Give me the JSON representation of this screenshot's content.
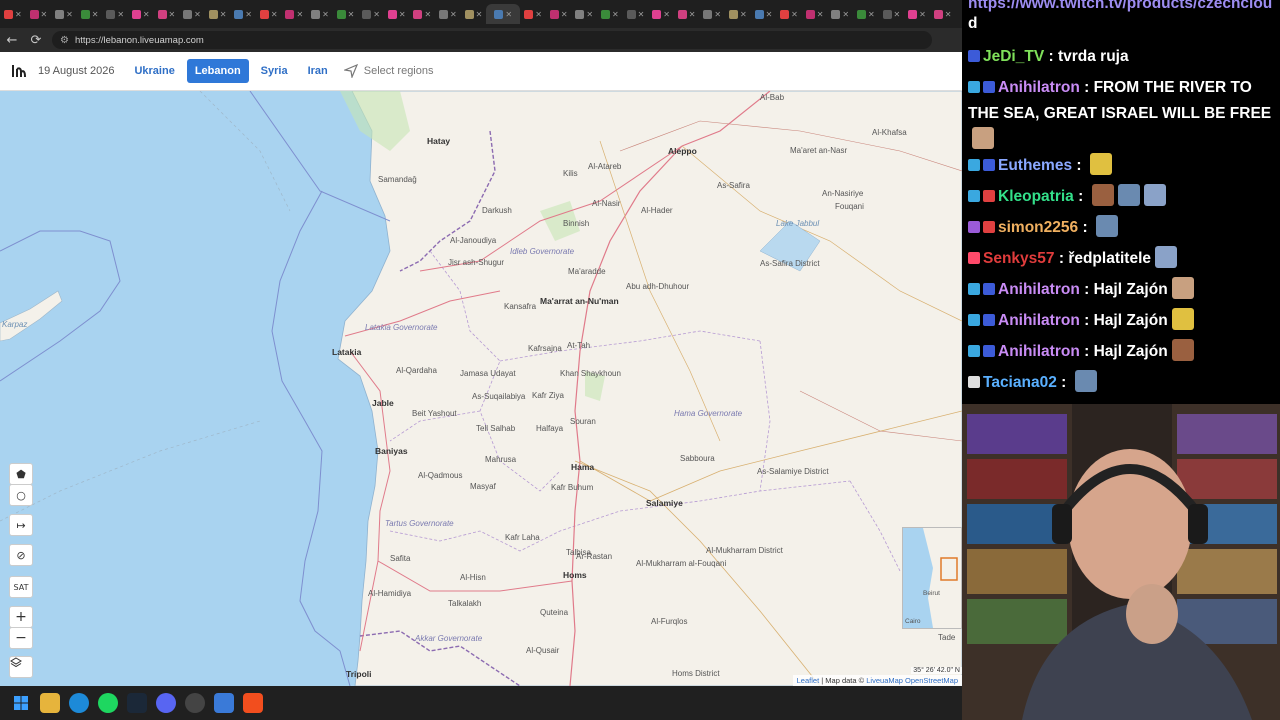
{
  "browser": {
    "url": "https://lebanon.liveuamap.com",
    "tab_count": 37
  },
  "site": {
    "date": "19 August 2026",
    "regions": [
      "Ukraine",
      "Lebanon",
      "Syria",
      "Iran"
    ],
    "active_region": "Lebanon",
    "select_regions_label": "Select regions"
  },
  "map": {
    "sea_labels": {
      "karpaz": "Karpaz"
    },
    "labels": [
      {
        "t": "Al-Bab",
        "k": "ml"
      },
      {
        "t": "Aleppo",
        "k": "city"
      },
      {
        "t": "As-Safira",
        "k": "ml"
      },
      {
        "t": "Hatay",
        "k": "city"
      },
      {
        "t": "Samandağ",
        "k": "ml"
      },
      {
        "t": "Kilis",
        "k": "ml"
      },
      {
        "t": "Al-Atareb",
        "k": "ml"
      },
      {
        "t": "Darkush",
        "k": "ml"
      },
      {
        "t": "Binnish",
        "k": "ml"
      },
      {
        "t": "Al-Nasir",
        "k": "ml"
      },
      {
        "t": "Al-Hader",
        "k": "ml"
      },
      {
        "t": "Al-Janoudiya",
        "k": "ml"
      },
      {
        "t": "Idleb Governorate",
        "k": "gov"
      },
      {
        "t": "Jisr ash-Shugur",
        "k": "ml"
      },
      {
        "t": "Ma'aradde",
        "k": "ml"
      },
      {
        "t": "Abu adh-Dhuhour",
        "k": "ml"
      },
      {
        "t": "Kansafra",
        "k": "ml"
      },
      {
        "t": "Ma'arrat an-Nu'man",
        "k": "city"
      },
      {
        "t": "Latakia Governorate",
        "k": "gov"
      },
      {
        "t": "Latakia",
        "k": "city"
      },
      {
        "t": "Kafrsajna",
        "k": "ml"
      },
      {
        "t": "At-Tah",
        "k": "ml"
      },
      {
        "t": "Al-Qardaha",
        "k": "ml"
      },
      {
        "t": "Jamasa Udayat",
        "k": "ml"
      },
      {
        "t": "Khan Shaykhoun",
        "k": "ml"
      },
      {
        "t": "As-Suqailabiya",
        "k": "ml"
      },
      {
        "t": "Kafr Ziya",
        "k": "ml"
      },
      {
        "t": "Jable",
        "k": "city"
      },
      {
        "t": "Beit Yashout",
        "k": "ml"
      },
      {
        "t": "Souran",
        "k": "ml"
      },
      {
        "t": "Hama Governorate",
        "k": "gov"
      },
      {
        "t": "Halfaya",
        "k": "ml"
      },
      {
        "t": "Tell Salhab",
        "k": "ml"
      },
      {
        "t": "Sabboura",
        "k": "ml"
      },
      {
        "t": "As-Salamiye District",
        "k": "ml"
      },
      {
        "t": "Baniyas",
        "k": "city"
      },
      {
        "t": "Mahrusa",
        "k": "ml"
      },
      {
        "t": "Hama",
        "k": "city"
      },
      {
        "t": "Al-Qadmous",
        "k": "ml"
      },
      {
        "t": "Masyaf",
        "k": "ml"
      },
      {
        "t": "Kafr Buhum",
        "k": "ml"
      },
      {
        "t": "Salamiye",
        "k": "city"
      },
      {
        "t": "Tartus Governorate",
        "k": "gov"
      },
      {
        "t": "Ar-Rastan",
        "k": "ml"
      },
      {
        "t": "Safita",
        "k": "ml"
      },
      {
        "t": "Kafr Laha",
        "k": "ml"
      },
      {
        "t": "Talbisa",
        "k": "ml"
      },
      {
        "t": "Al-Mukharram al-Fouqani",
        "k": "ml"
      },
      {
        "t": "Al-Mukharram District",
        "k": "ml"
      },
      {
        "t": "Al-Hisn",
        "k": "ml"
      },
      {
        "t": "Homs",
        "k": "city"
      },
      {
        "t": "Al-Hamidiya",
        "k": "ml"
      },
      {
        "t": "Talkalakh",
        "k": "ml"
      },
      {
        "t": "Quteina",
        "k": "ml"
      },
      {
        "t": "Akkar Governorate",
        "k": "gov"
      },
      {
        "t": "Al-Furqlos",
        "k": "ml"
      },
      {
        "t": "Al-Qusair",
        "k": "ml"
      },
      {
        "t": "Tripoli",
        "k": "city"
      },
      {
        "t": "Homs District",
        "k": "ml"
      },
      {
        "t": "Lake Jabbul",
        "k": "sea"
      },
      {
        "t": "An-Nasiriye",
        "k": "ml"
      },
      {
        "t": "Fouqani",
        "k": "ml"
      },
      {
        "t": "As-Safira District",
        "k": "ml"
      },
      {
        "t": "Al-Khafsa",
        "k": "ml"
      },
      {
        "t": "Ma'aret an-Nasr",
        "k": "ml"
      }
    ],
    "minimap_labels": [
      "Beirut",
      "Cairo",
      "Tade"
    ],
    "coords": "35° 26' 42.0\" N",
    "attribution": {
      "leaflet": "Leaflet",
      "sep": " | Map data © ",
      "provider": "LiveuaMap OpenStreetMap"
    },
    "controls": [
      "polygon",
      "circle",
      "line",
      "hide",
      "SAT",
      "+",
      "−",
      "layers"
    ]
  },
  "chat": {
    "url_line": "https://www.twitch.tv/products/czechclou",
    "url_tail": "d",
    "messages": [
      {
        "user": "JeDi_TV",
        "color": "#7fe05a",
        "text": "tvrda ruja",
        "badges": [
          "#3c5bd8"
        ]
      },
      {
        "user": "Anihilatron",
        "color": "#c98cf5",
        "text": "FROM THE RIVER TO THE SEA, GREAT ISRAEL WILL BE FREE",
        "badges": [
          "#3aa8e0",
          "#3c5bd8"
        ],
        "emotes": 1
      },
      {
        "user": "Euthemes",
        "color": "#8aa8ff",
        "text": "",
        "badges": [
          "#3aa8e0",
          "#3c5bd8"
        ],
        "emotes": 1
      },
      {
        "user": "Kleopatria",
        "color": "#33e08a",
        "text": "",
        "badges": [
          "#3aa8e0",
          "#e04040"
        ],
        "emotes": 3
      },
      {
        "user": "simon2256",
        "color": "#f0b060",
        "text": "",
        "badges": [
          "#9a5bd8",
          "#e04040"
        ],
        "emotes": 1
      },
      {
        "user": "Senkys57",
        "color": "#e03c3c",
        "text": "ředplatitele",
        "badges": [
          "#ff4a6a"
        ],
        "emotes": 1
      },
      {
        "user": "Anihilatron",
        "color": "#c98cf5",
        "text": "Hajl Zajón",
        "badges": [
          "#3aa8e0",
          "#3c5bd8"
        ],
        "emotes": 1
      },
      {
        "user": "Anihilatron",
        "color": "#c98cf5",
        "text": "Hajl Zajón",
        "badges": [
          "#3aa8e0",
          "#3c5bd8"
        ],
        "emotes": 1
      },
      {
        "user": "Anihilatron",
        "color": "#c98cf5",
        "text": "Hajl Zajón",
        "badges": [
          "#3aa8e0",
          "#3c5bd8"
        ],
        "emotes": 1
      },
      {
        "user": "Taciana02",
        "color": "#5ab0ff",
        "text": "",
        "badges": [
          "#dddddd"
        ],
        "emotes": 1
      }
    ]
  },
  "taskbar": {
    "icons": [
      "windows-start",
      "file-explorer",
      "edge-browser",
      "spotify",
      "steam",
      "discord",
      "chrome",
      "notepad",
      "figma"
    ]
  },
  "colors": {
    "accent": "#2f78d8",
    "sea": "#a9d3f0",
    "land": "#f4f1ea"
  }
}
